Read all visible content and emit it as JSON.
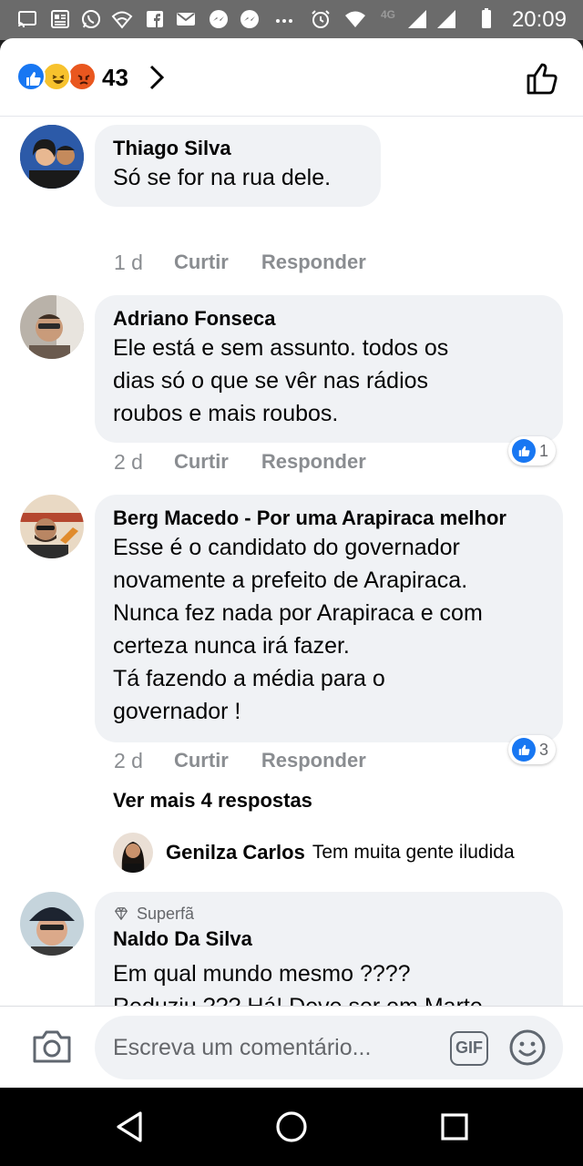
{
  "status_bar": {
    "time": "20:09",
    "network": "4G",
    "icons": [
      "cast-icon",
      "news-icon",
      "whatsapp-icon",
      "wifi-icon",
      "facebook-icon",
      "mail-icon",
      "messenger-icon",
      "messenger-icon",
      "more-icon",
      "alarm-icon",
      "wifi-signal-icon",
      "cell-signal-icon",
      "battery-icon"
    ]
  },
  "header": {
    "reaction_count": "43",
    "reaction_types": [
      "like",
      "haha",
      "angry"
    ]
  },
  "comments": [
    {
      "author": "Thiago Silva",
      "text": "Só se for na rua dele.",
      "time": "1 d",
      "like_label": "Curtir",
      "reply_label": "Responder"
    },
    {
      "author": "Adriano Fonseca",
      "text": "Ele está e sem assunto. todos os\ndias só o que se vêr nas rádios\nroubos e mais roubos.",
      "time": "2 d",
      "like_label": "Curtir",
      "reply_label": "Responder",
      "reactions": "1"
    },
    {
      "author": "Berg Macedo - Por uma Arapiraca melhor",
      "text": "Esse é o candidato do governador\nnovamente a prefeito de Arapiraca.\nNunca fez nada por Arapiraca e com\ncerteza nunca irá fazer.\nTá fazendo a média para o\ngovernador !",
      "time": "2 d",
      "like_label": "Curtir",
      "reply_label": "Responder",
      "reactions": "3",
      "more_replies": "Ver mais 4 respostas",
      "reply_preview": {
        "author": "Genilza Carlos",
        "text": "Tem muita gente iludida"
      }
    },
    {
      "badge": "Superfã",
      "author": "Naldo Da Silva",
      "text": "Em qual mundo mesmo ????\nReduziu ??? Há! Deve ser em Marte ,\nlá não existe habitantes"
    }
  ],
  "composer": {
    "placeholder": "Escreva um comentário...",
    "gif_label": "GIF"
  },
  "colors": {
    "accent": "#1877f2",
    "bubble": "#f0f2f5",
    "meta_text": "#8a8d91"
  }
}
